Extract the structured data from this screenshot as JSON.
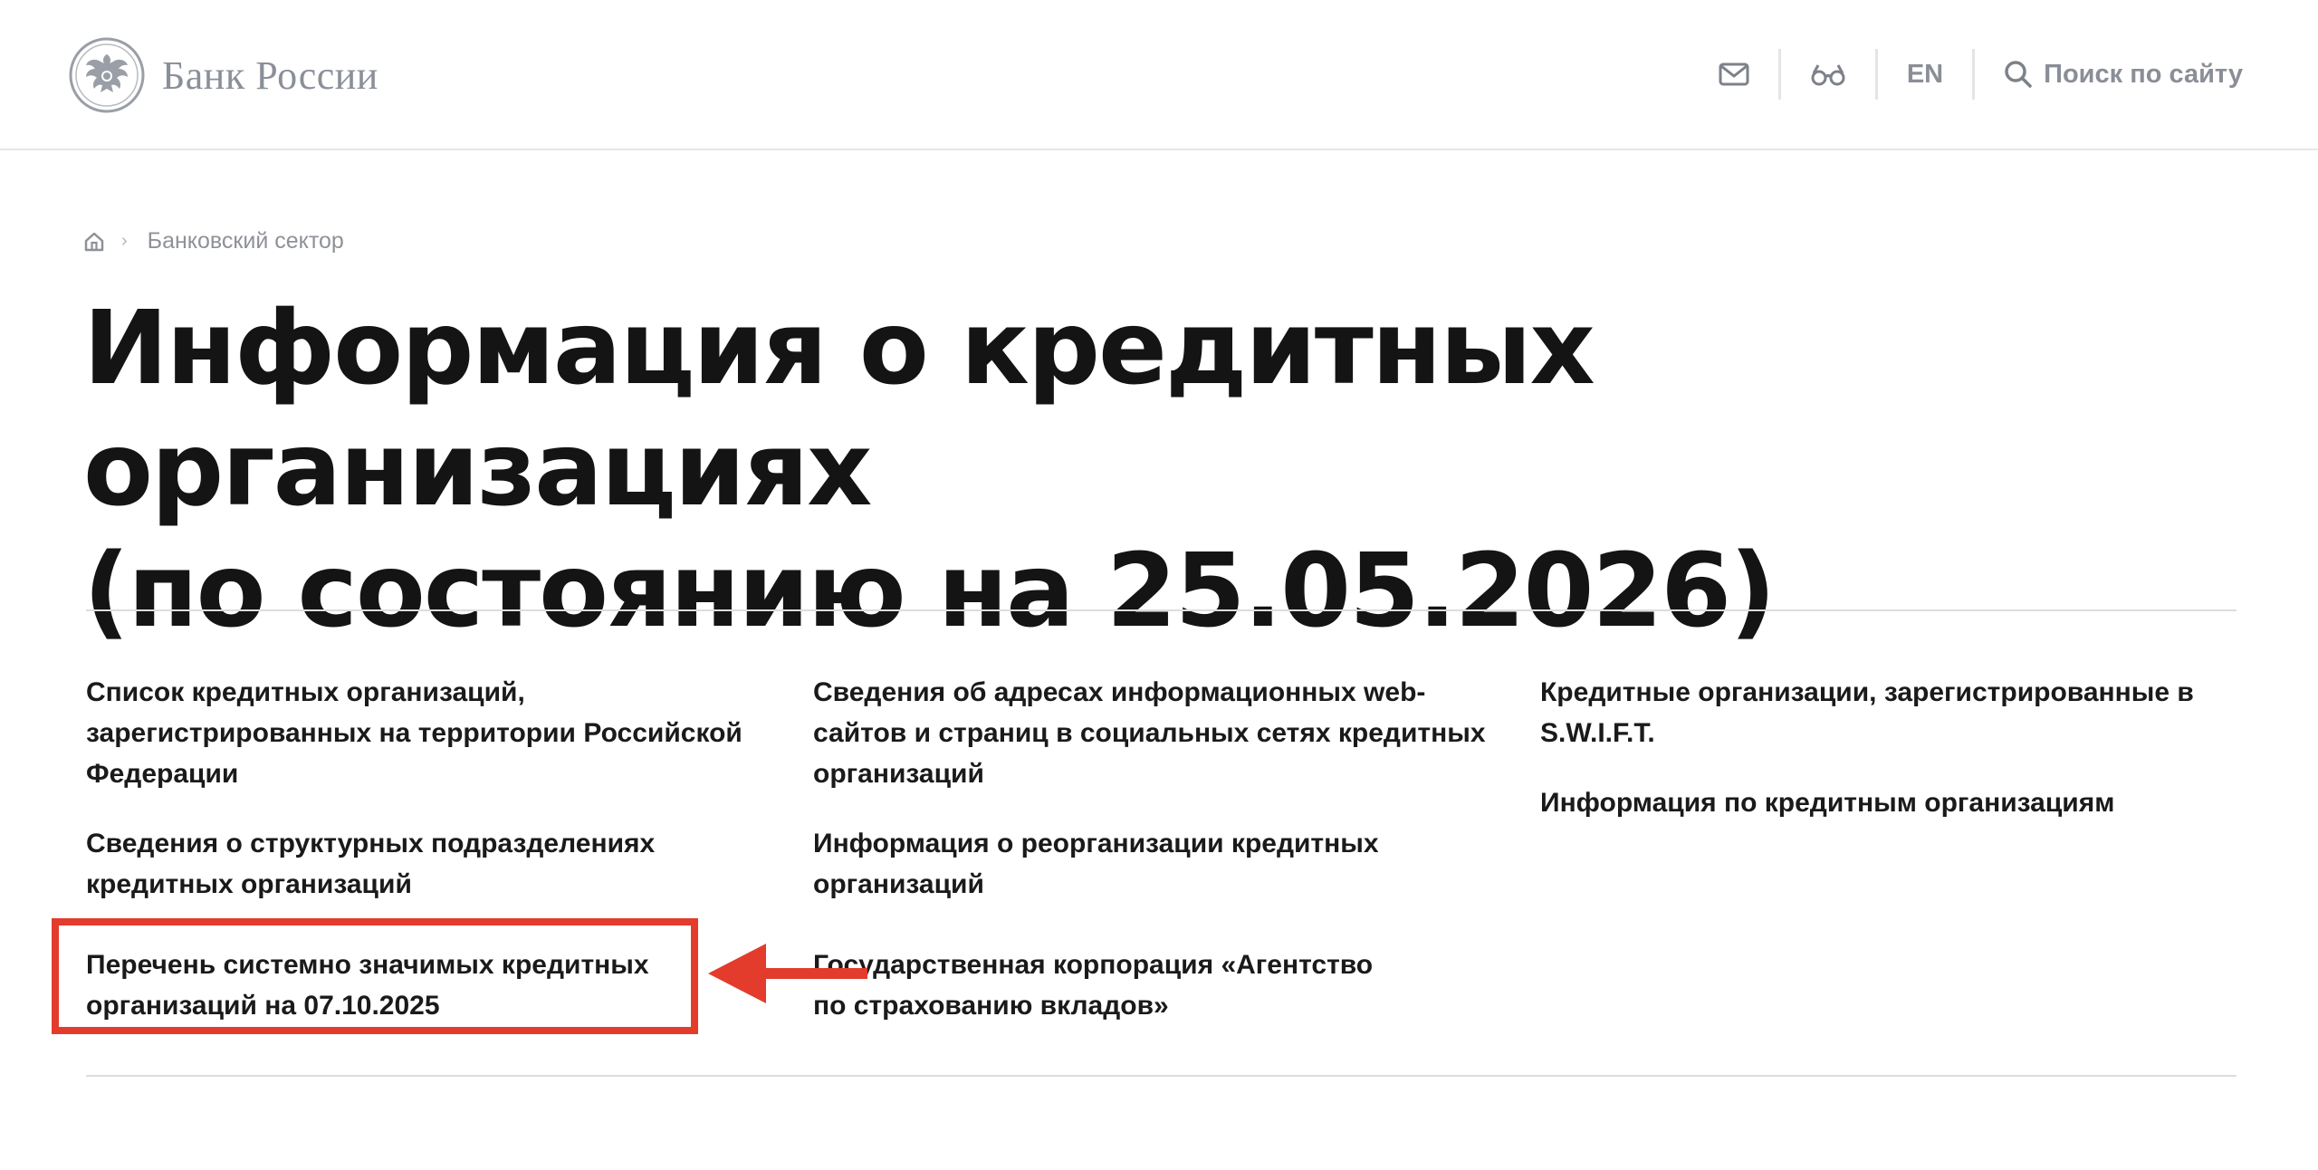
{
  "header": {
    "logo_text": "Банк России",
    "lang_label": "EN",
    "search_label": "Поиск по сайту",
    "icons": [
      "mail-icon",
      "glasses-icon",
      "search-icon"
    ]
  },
  "breadcrumb": {
    "items": [
      "Банковский сектор"
    ]
  },
  "page": {
    "title_line1": "Информация о кредитных организациях",
    "title_line2": "(по состоянию на 25.05.2026)"
  },
  "links": {
    "col1": [
      "Список кредитных организаций, зарегистрированных на территории Российской Федерации",
      "Сведения о структурных подразделениях кредитных организаций",
      "Перечень системно значимых кредитных организаций на 07.10.2025"
    ],
    "col2": [
      "Сведения об адресах информационных web-сайтов и страниц в социальных сетях кредитных организаций",
      "Информация о реорганизации кредитных организаций",
      "Государственная корпорация «Агентство по страхованию вкладов»"
    ],
    "col3": [
      "Кредитные организации, зарегистрированные в S.W.I.F.T.",
      "Информация по кредитным организациям"
    ]
  },
  "colors": {
    "accent_annotation": "#e33c2c",
    "muted_text": "#8a8e96",
    "title_text": "#141414"
  }
}
